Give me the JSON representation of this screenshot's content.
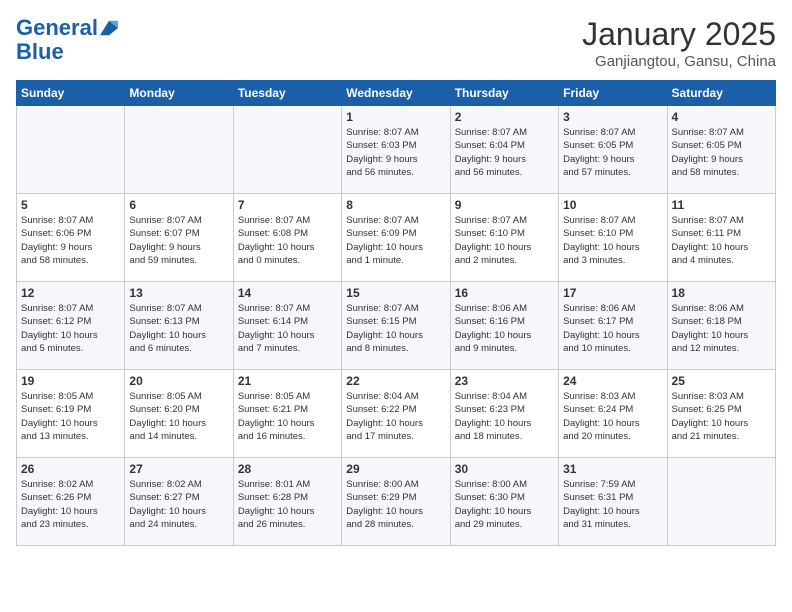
{
  "logo": {
    "line1": "General",
    "line2": "Blue"
  },
  "title": "January 2025",
  "subtitle": "Ganjiangtou, Gansu, China",
  "weekdays": [
    "Sunday",
    "Monday",
    "Tuesday",
    "Wednesday",
    "Thursday",
    "Friday",
    "Saturday"
  ],
  "weeks": [
    [
      {
        "day": "",
        "info": ""
      },
      {
        "day": "",
        "info": ""
      },
      {
        "day": "",
        "info": ""
      },
      {
        "day": "1",
        "info": "Sunrise: 8:07 AM\nSunset: 6:03 PM\nDaylight: 9 hours\nand 56 minutes."
      },
      {
        "day": "2",
        "info": "Sunrise: 8:07 AM\nSunset: 6:04 PM\nDaylight: 9 hours\nand 56 minutes."
      },
      {
        "day": "3",
        "info": "Sunrise: 8:07 AM\nSunset: 6:05 PM\nDaylight: 9 hours\nand 57 minutes."
      },
      {
        "day": "4",
        "info": "Sunrise: 8:07 AM\nSunset: 6:05 PM\nDaylight: 9 hours\nand 58 minutes."
      }
    ],
    [
      {
        "day": "5",
        "info": "Sunrise: 8:07 AM\nSunset: 6:06 PM\nDaylight: 9 hours\nand 58 minutes."
      },
      {
        "day": "6",
        "info": "Sunrise: 8:07 AM\nSunset: 6:07 PM\nDaylight: 9 hours\nand 59 minutes."
      },
      {
        "day": "7",
        "info": "Sunrise: 8:07 AM\nSunset: 6:08 PM\nDaylight: 10 hours\nand 0 minutes."
      },
      {
        "day": "8",
        "info": "Sunrise: 8:07 AM\nSunset: 6:09 PM\nDaylight: 10 hours\nand 1 minute."
      },
      {
        "day": "9",
        "info": "Sunrise: 8:07 AM\nSunset: 6:10 PM\nDaylight: 10 hours\nand 2 minutes."
      },
      {
        "day": "10",
        "info": "Sunrise: 8:07 AM\nSunset: 6:10 PM\nDaylight: 10 hours\nand 3 minutes."
      },
      {
        "day": "11",
        "info": "Sunrise: 8:07 AM\nSunset: 6:11 PM\nDaylight: 10 hours\nand 4 minutes."
      }
    ],
    [
      {
        "day": "12",
        "info": "Sunrise: 8:07 AM\nSunset: 6:12 PM\nDaylight: 10 hours\nand 5 minutes."
      },
      {
        "day": "13",
        "info": "Sunrise: 8:07 AM\nSunset: 6:13 PM\nDaylight: 10 hours\nand 6 minutes."
      },
      {
        "day": "14",
        "info": "Sunrise: 8:07 AM\nSunset: 6:14 PM\nDaylight: 10 hours\nand 7 minutes."
      },
      {
        "day": "15",
        "info": "Sunrise: 8:07 AM\nSunset: 6:15 PM\nDaylight: 10 hours\nand 8 minutes."
      },
      {
        "day": "16",
        "info": "Sunrise: 8:06 AM\nSunset: 6:16 PM\nDaylight: 10 hours\nand 9 minutes."
      },
      {
        "day": "17",
        "info": "Sunrise: 8:06 AM\nSunset: 6:17 PM\nDaylight: 10 hours\nand 10 minutes."
      },
      {
        "day": "18",
        "info": "Sunrise: 8:06 AM\nSunset: 6:18 PM\nDaylight: 10 hours\nand 12 minutes."
      }
    ],
    [
      {
        "day": "19",
        "info": "Sunrise: 8:05 AM\nSunset: 6:19 PM\nDaylight: 10 hours\nand 13 minutes."
      },
      {
        "day": "20",
        "info": "Sunrise: 8:05 AM\nSunset: 6:20 PM\nDaylight: 10 hours\nand 14 minutes."
      },
      {
        "day": "21",
        "info": "Sunrise: 8:05 AM\nSunset: 6:21 PM\nDaylight: 10 hours\nand 16 minutes."
      },
      {
        "day": "22",
        "info": "Sunrise: 8:04 AM\nSunset: 6:22 PM\nDaylight: 10 hours\nand 17 minutes."
      },
      {
        "day": "23",
        "info": "Sunrise: 8:04 AM\nSunset: 6:23 PM\nDaylight: 10 hours\nand 18 minutes."
      },
      {
        "day": "24",
        "info": "Sunrise: 8:03 AM\nSunset: 6:24 PM\nDaylight: 10 hours\nand 20 minutes."
      },
      {
        "day": "25",
        "info": "Sunrise: 8:03 AM\nSunset: 6:25 PM\nDaylight: 10 hours\nand 21 minutes."
      }
    ],
    [
      {
        "day": "26",
        "info": "Sunrise: 8:02 AM\nSunset: 6:26 PM\nDaylight: 10 hours\nand 23 minutes."
      },
      {
        "day": "27",
        "info": "Sunrise: 8:02 AM\nSunset: 6:27 PM\nDaylight: 10 hours\nand 24 minutes."
      },
      {
        "day": "28",
        "info": "Sunrise: 8:01 AM\nSunset: 6:28 PM\nDaylight: 10 hours\nand 26 minutes."
      },
      {
        "day": "29",
        "info": "Sunrise: 8:00 AM\nSunset: 6:29 PM\nDaylight: 10 hours\nand 28 minutes."
      },
      {
        "day": "30",
        "info": "Sunrise: 8:00 AM\nSunset: 6:30 PM\nDaylight: 10 hours\nand 29 minutes."
      },
      {
        "day": "31",
        "info": "Sunrise: 7:59 AM\nSunset: 6:31 PM\nDaylight: 10 hours\nand 31 minutes."
      },
      {
        "day": "",
        "info": ""
      }
    ]
  ]
}
